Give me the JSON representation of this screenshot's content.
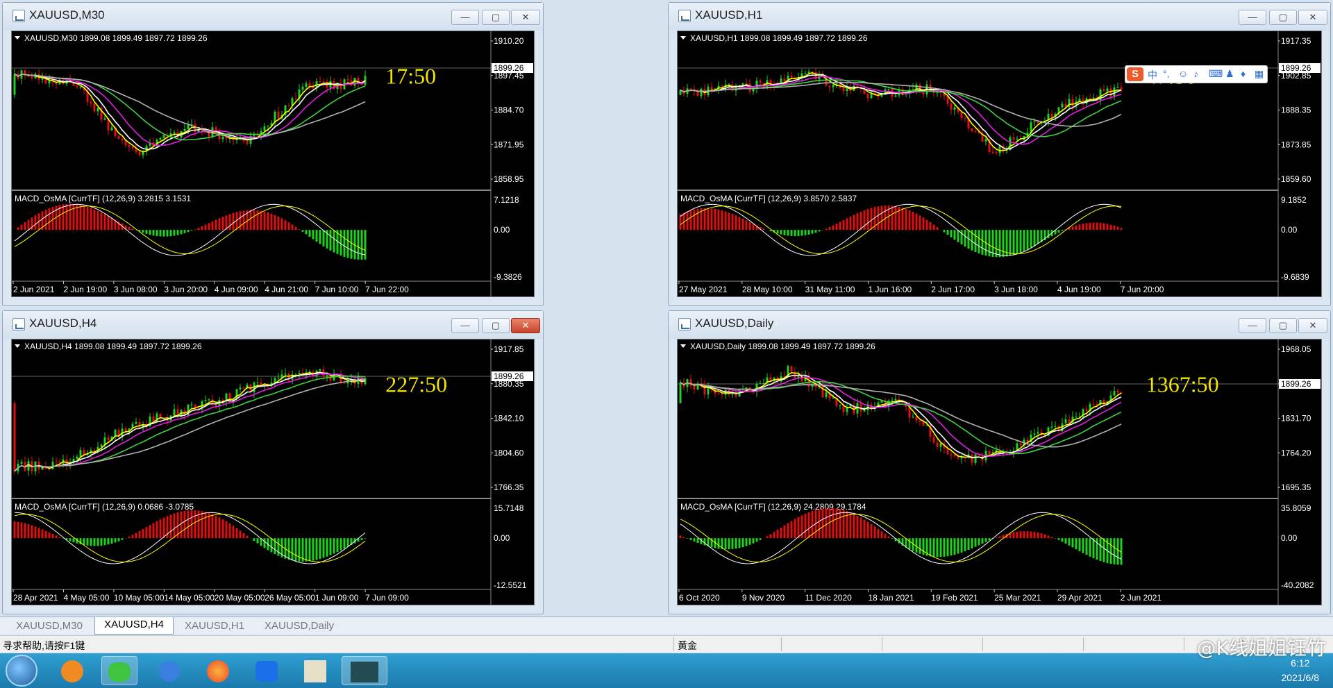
{
  "windows": [
    {
      "title": "XAUUSD,M30",
      "header": "XAUUSD,M30  1899.08 1899.49 1897.72 1899.26",
      "timer": "17:50",
      "price_ticks": [
        "1910.20",
        "1897.45",
        "1884.70",
        "1871.95",
        "1858.95"
      ],
      "current_price": "1899.26",
      "macd_label": "MACD_OsMA [CurrTF] (12,26,9) 3.2815 3.1531",
      "macd_ticks": [
        "7.1218",
        "0.00",
        "-9.3826"
      ],
      "time_ticks": [
        "2 Jun 2021",
        "2 Jun 19:00",
        "3 Jun 08:00",
        "3 Jun 20:00",
        "4 Jun 09:00",
        "4 Jun 21:00",
        "7 Jun 10:00",
        "7 Jun 22:00"
      ],
      "close_red": false
    },
    {
      "title": "XAUUSD,H1",
      "header": "XAUUSD,H1  1899.08 1899.49 1897.72 1899.26",
      "timer": "47:50",
      "price_ticks": [
        "1917.35",
        "1902.85",
        "1888.35",
        "1873.85",
        "1859.60"
      ],
      "current_price": "1899.26",
      "macd_label": "MACD_OsMA [CurrTF] (12,26,9) 3.8570 2.5837",
      "macd_ticks": [
        "9.1852",
        "0.00",
        "-9.6839"
      ],
      "time_ticks": [
        "27 May 2021",
        "28 May 10:00",
        "31 May 11:00",
        "1 Jun 16:00",
        "2 Jun 17:00",
        "3 Jun 18:00",
        "4 Jun 19:00",
        "7 Jun 20:00"
      ],
      "close_red": false
    },
    {
      "title": "XAUUSD,H4",
      "header": "XAUUSD,H4  1899.08 1899.49 1897.72 1899.26",
      "timer": "227:50",
      "price_ticks": [
        "1917.85",
        "1880.35",
        "1842.10",
        "1804.60",
        "1766.35"
      ],
      "current_price": "1899.26",
      "macd_label": "MACD_OsMA [CurrTF] (12,26,9) 0.0686 -3.0785",
      "macd_ticks": [
        "15.7148",
        "0.00",
        "-12.5521"
      ],
      "time_ticks": [
        "28 Apr 2021",
        "4 May 05:00",
        "10 May 05:00",
        "14 May 05:00",
        "20 May 05:00",
        "26 May 05:00",
        "1 Jun 09:00",
        "7 Jun 09:00"
      ],
      "close_red": true
    },
    {
      "title": "XAUUSD,Daily",
      "header": "XAUUSD,Daily  1899.08 1899.49 1897.72 1899.26",
      "timer": "1367:50",
      "price_ticks": [
        "1968.05",
        "1899.26",
        "1831.70",
        "1764.20",
        "1695.35"
      ],
      "current_price": "1899.26",
      "macd_label": "MACD_OsMA [CurrTF] (12,26,9) 24.2809 29.1784",
      "macd_ticks": [
        "35.8059",
        "0.00",
        "-40.2082"
      ],
      "time_ticks": [
        "6 Oct 2020",
        "9 Nov 2020",
        "11 Dec 2020",
        "18 Jan 2021",
        "19 Feb 2021",
        "25 Mar 2021",
        "29 Apr 2021",
        "2 Jun 2021"
      ],
      "close_red": false
    }
  ],
  "tabs": [
    "XAUUSD,M30",
    "XAUUSD,H4",
    "XAUUSD,H1",
    "XAUUSD,Daily"
  ],
  "active_tab": "XAUUSD,H4",
  "status": {
    "help": "寻求帮助,请按F1键",
    "symbol": "黄金"
  },
  "clock": {
    "time": "6:12",
    "date": "2021/6/8"
  },
  "watermark": "@K线姐姐钰竹",
  "colors": {
    "bull": "#1fd21f",
    "bear": "#e01010",
    "ma_yellow": "#ffff00",
    "ma_white": "#ffffff",
    "ma_magenta": "#e020e0",
    "ma_green": "#40d040",
    "ma_gray": "#b0b0b0",
    "timer": "#f2e400"
  }
}
